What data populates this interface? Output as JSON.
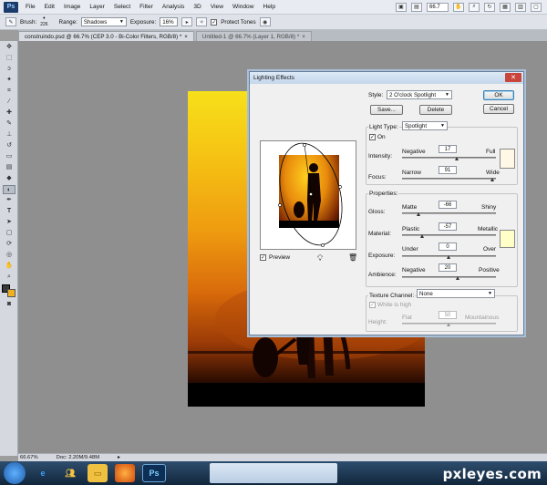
{
  "app": {
    "logo": "Ps"
  },
  "menu": [
    "File",
    "Edit",
    "Image",
    "Layer",
    "Select",
    "Filter",
    "Analysis",
    "3D",
    "View",
    "Window",
    "Help"
  ],
  "menu_right": {
    "zoom": "66.7"
  },
  "options": {
    "brush_label": "Brush:",
    "brush_size": "226",
    "range_label": "Range:",
    "range_value": "Shadows",
    "exposure_label": "Exposure:",
    "exposure_value": "16%",
    "protect_tones": "Protect Tones"
  },
  "tabs": [
    {
      "label": "construindo.psd @ 66.7% (CEP 3.0 - Bi-Color Filters, RGB/8) *"
    },
    {
      "label": "Untitled-1 @ 66.7% (Layer 1, RGB/8) *"
    }
  ],
  "dialog": {
    "title": "Lighting Effects",
    "style_label": "Style:",
    "style_value": "2 O'clock Spotlight",
    "save": "Save...",
    "delete": "Delete",
    "ok": "OK",
    "cancel": "Cancel",
    "light_type_label": "Light Type:",
    "light_type_value": "Spotlight",
    "on_label": "On",
    "intensity_label": "Intensity:",
    "intensity_min": "Negative",
    "intensity_value": "17",
    "intensity_max": "Full",
    "focus_label": "Focus:",
    "focus_min": "Narrow",
    "focus_value": "91",
    "focus_max": "Wide",
    "properties_label": "Properties:",
    "gloss_label": "Gloss:",
    "gloss_min": "Matte",
    "gloss_value": "-66",
    "gloss_max": "Shiny",
    "material_label": "Material:",
    "material_min": "Plastic",
    "material_value": "-57",
    "material_max": "Metallic",
    "exposure_label": "Exposure:",
    "exposure_min": "Under",
    "exposure_value": "0",
    "exposure_max": "Over",
    "ambience_label": "Ambience:",
    "ambience_min": "Negative",
    "ambience_value": "20",
    "ambience_max": "Positive",
    "texture_label": "Texture Channel:",
    "texture_value": "None",
    "white_high": "White is high",
    "height_label": "Height:",
    "height_min": "Flat",
    "height_value": "50",
    "height_max": "Mountainous",
    "preview_label": "Preview",
    "light_color": "#fff8e6",
    "ambience_color": "#ffffc8"
  },
  "status": {
    "zoom": "66.67%",
    "doc": "Doc: 2.20M/9.48M"
  },
  "taskbar": {
    "ps": "Ps"
  },
  "watermark": "pxleyes.com"
}
